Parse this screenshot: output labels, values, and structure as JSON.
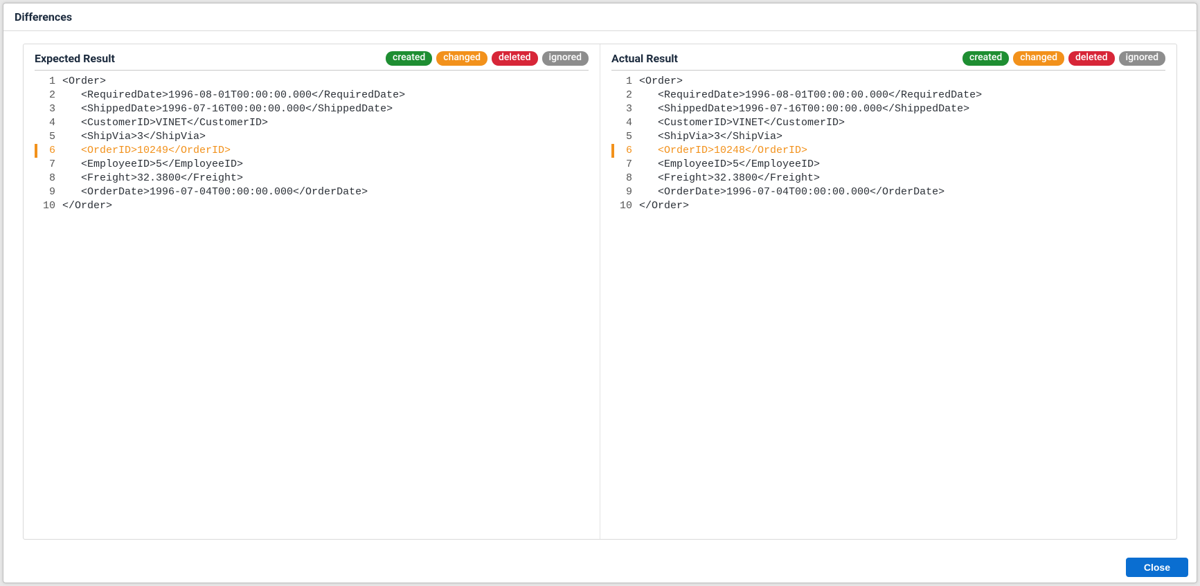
{
  "dialog": {
    "title": "Differences",
    "close_label": "Close"
  },
  "legend": {
    "created": "created",
    "changed": "changed",
    "deleted": "deleted",
    "ignored": "ignored"
  },
  "panels": {
    "expected": {
      "title": "Expected Result",
      "lines": [
        {
          "n": "1",
          "state": "",
          "text": "<Order>"
        },
        {
          "n": "2",
          "state": "",
          "text": "   <RequiredDate>1996-08-01T00:00:00.000</RequiredDate>"
        },
        {
          "n": "3",
          "state": "",
          "text": "   <ShippedDate>1996-07-16T00:00:00.000</ShippedDate>"
        },
        {
          "n": "4",
          "state": "",
          "text": "   <CustomerID>VINET</CustomerID>"
        },
        {
          "n": "5",
          "state": "",
          "text": "   <ShipVia>3</ShipVia>"
        },
        {
          "n": "6",
          "state": "changed",
          "text": "   <OrderID>10249</OrderID>"
        },
        {
          "n": "7",
          "state": "",
          "text": "   <EmployeeID>5</EmployeeID>"
        },
        {
          "n": "8",
          "state": "",
          "text": "   <Freight>32.3800</Freight>"
        },
        {
          "n": "9",
          "state": "",
          "text": "   <OrderDate>1996-07-04T00:00:00.000</OrderDate>"
        },
        {
          "n": "10",
          "state": "",
          "text": "</Order>"
        }
      ]
    },
    "actual": {
      "title": "Actual Result",
      "lines": [
        {
          "n": "1",
          "state": "",
          "text": "<Order>"
        },
        {
          "n": "2",
          "state": "",
          "text": "   <RequiredDate>1996-08-01T00:00:00.000</RequiredDate>"
        },
        {
          "n": "3",
          "state": "",
          "text": "   <ShippedDate>1996-07-16T00:00:00.000</ShippedDate>"
        },
        {
          "n": "4",
          "state": "",
          "text": "   <CustomerID>VINET</CustomerID>"
        },
        {
          "n": "5",
          "state": "",
          "text": "   <ShipVia>3</ShipVia>"
        },
        {
          "n": "6",
          "state": "changed",
          "text": "   <OrderID>10248</OrderID>"
        },
        {
          "n": "7",
          "state": "",
          "text": "   <EmployeeID>5</EmployeeID>"
        },
        {
          "n": "8",
          "state": "",
          "text": "   <Freight>32.3800</Freight>"
        },
        {
          "n": "9",
          "state": "",
          "text": "   <OrderDate>1996-07-04T00:00:00.000</OrderDate>"
        },
        {
          "n": "10",
          "state": "",
          "text": "</Order>"
        }
      ]
    }
  }
}
